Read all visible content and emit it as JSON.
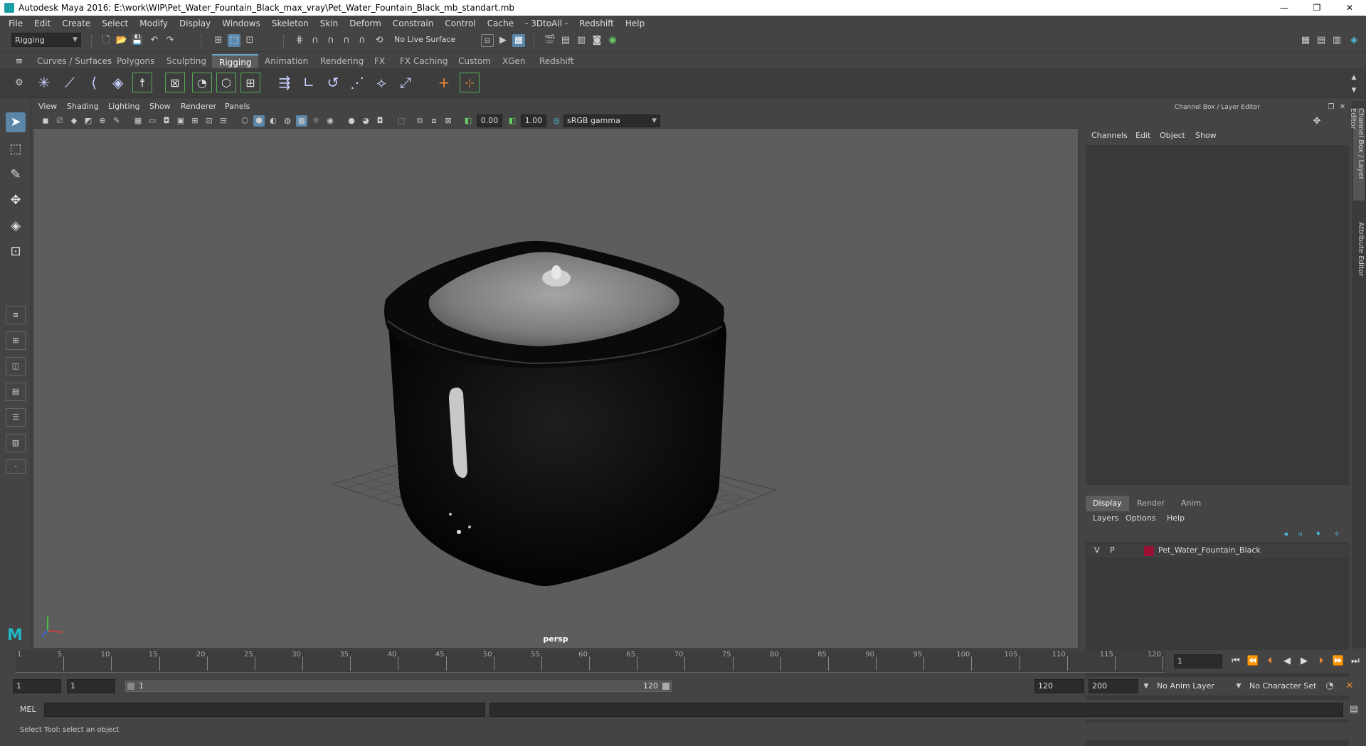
{
  "window": {
    "title": "Autodesk Maya 2016: E:\\work\\WIP\\Pet_Water_Fountain_Black_max_vray\\Pet_Water_Fountain_Black_mb_standart.mb",
    "minimize": "—",
    "restore": "❐",
    "close": "✕"
  },
  "menubar": [
    "File",
    "Edit",
    "Create",
    "Select",
    "Modify",
    "Display",
    "Windows",
    "Skeleton",
    "Skin",
    "Deform",
    "Constrain",
    "Control",
    "Cache",
    "- 3DtoAll -",
    "Redshift",
    "Help"
  ],
  "statusline": {
    "mode": "Rigging",
    "live_surface": "No Live Surface"
  },
  "shelf_tabs": [
    "Curves / Surfaces",
    "Polygons",
    "Sculpting",
    "Rigging",
    "Animation",
    "Rendering",
    "FX",
    "FX Caching",
    "Custom",
    "XGen",
    "Redshift"
  ],
  "active_shelf_tab": "Rigging",
  "viewport": {
    "menu": [
      "View",
      "Shading",
      "Lighting",
      "Show",
      "Renderer",
      "Panels"
    ],
    "exposure": "0.00",
    "gamma": "1.00",
    "color_space": "sRGB gamma",
    "camera": "persp"
  },
  "channel_box": {
    "header": "Channel Box / Layer Editor",
    "menu": [
      "Channels",
      "Edit",
      "Object",
      "Show"
    ]
  },
  "layer_editor": {
    "tabs": [
      "Display",
      "Render",
      "Anim"
    ],
    "active_tab": "Display",
    "menu": [
      "Layers",
      "Options",
      "Help"
    ],
    "layers": [
      {
        "v": "V",
        "p": "P",
        "name": "Pet_Water_Fountain_Black",
        "color": "#9a1133"
      }
    ]
  },
  "side_tabs": [
    "Channel Box / Layer Editor",
    "Attribute Editor"
  ],
  "timeline": {
    "ticks": [
      5,
      10,
      15,
      20,
      25,
      30,
      35,
      40,
      45,
      50,
      55,
      60,
      65,
      70,
      75,
      80,
      85,
      90,
      95,
      100,
      105,
      110,
      115,
      120
    ],
    "start_label": "1",
    "current_frame": "1",
    "max": 120
  },
  "range": {
    "start": "1",
    "playback_start": "1",
    "bar_start": "1",
    "bar_end": "120",
    "playback_end": "120",
    "end": "200",
    "anim_layer": "No Anim Layer",
    "character_set": "No Character Set"
  },
  "command_line": {
    "label": "MEL"
  },
  "help_line": "Select Tool: select an object",
  "colors": {
    "accent": "#5b86a8",
    "layer_swatch": "#9a1133"
  }
}
